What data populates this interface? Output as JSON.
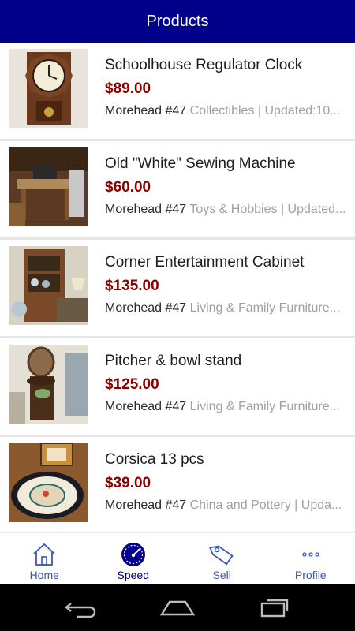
{
  "app_bar": {
    "title": "Products"
  },
  "products": [
    {
      "title": "Schoolhouse Regulator Clock",
      "price": "$89.00",
      "store": "Morehead #47",
      "category": "Collectibles | Updated:10..."
    },
    {
      "title": "Old \"White\" Sewing Machine",
      "price": "$60.00",
      "store": "Morehead #47",
      "category": "Toys & Hobbies | Updated..."
    },
    {
      "title": "Corner Entertainment Cabinet",
      "price": "$135.00",
      "store": "Morehead #47",
      "category": "Living & Family Furniture..."
    },
    {
      "title": "Pitcher & bowl stand",
      "price": "$125.00",
      "store": "Morehead #47",
      "category": "Living & Family Furniture..."
    },
    {
      "title": "Corsica 13 pcs",
      "price": "$39.00",
      "store": "Morehead #47",
      "category": "China and Pottery | Upda..."
    }
  ],
  "tabs": [
    {
      "label": "Home",
      "icon": "home-icon"
    },
    {
      "label": "Speed",
      "icon": "speedometer-icon",
      "active": true
    },
    {
      "label": "Sell",
      "icon": "tag-icon"
    },
    {
      "label": "Profile",
      "icon": "more-dots-icon"
    }
  ],
  "system_nav": {
    "icons": [
      "back-icon",
      "home-icon",
      "recents-icon"
    ]
  },
  "colors": {
    "app_bar": "#00008b",
    "price": "#8b0000",
    "tab_label": "#3a55b4",
    "category": "#a0a0a0"
  }
}
